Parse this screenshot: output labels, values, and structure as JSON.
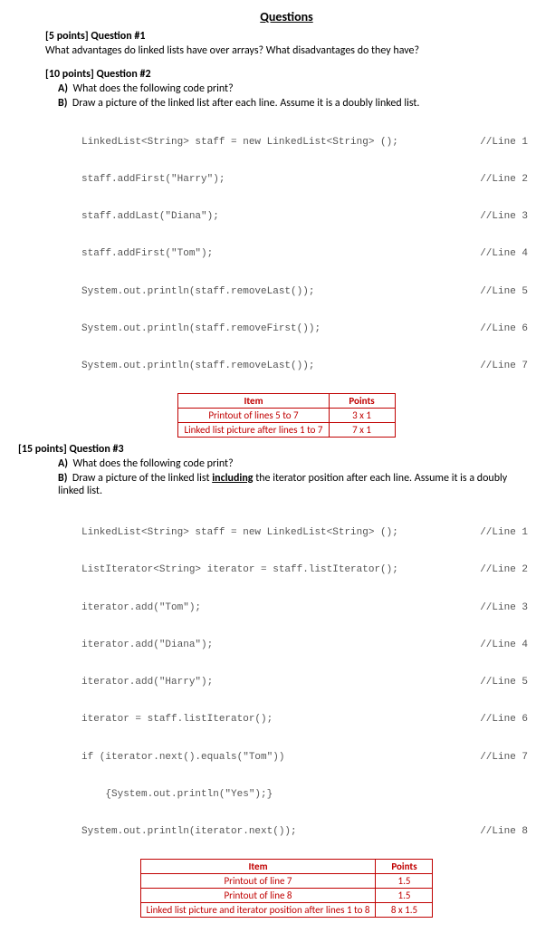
{
  "title": "Questions",
  "q1": {
    "header": "[5 points] Question #1",
    "text": "What advantages do linked lists have over arrays? What disadvantages do they have?"
  },
  "q2": {
    "header": "[10 points] Question #2",
    "partA": "What does the following code print?",
    "partB": "Draw a picture of the linked list after each line. Assume it is a doubly linked list.",
    "code": [
      {
        "l": "LinkedList<String> staff = new LinkedList<String> ();",
        "r": "//Line 1"
      },
      {
        "l": "staff.addFirst(\"Harry\");",
        "r": "//Line 2"
      },
      {
        "l": "staff.addLast(\"Diana\");",
        "r": "//Line 3"
      },
      {
        "l": "staff.addFirst(\"Tom\");",
        "r": "//Line 4"
      },
      {
        "l": "System.out.println(staff.removeLast());",
        "r": "//Line 5"
      },
      {
        "l": "System.out.println(staff.removeFirst());",
        "r": "//Line 6"
      },
      {
        "l": "System.out.println(staff.removeLast());",
        "r": "//Line 7"
      }
    ],
    "rubric": {
      "h1": "Item",
      "h2": "Points",
      "rows": [
        {
          "item": "Printout of lines 5 to 7",
          "pts": "3 x 1"
        },
        {
          "item": "Linked list picture after lines 1 to 7",
          "pts": "7 x 1"
        }
      ]
    }
  },
  "q3": {
    "header": "[15 points] Question #3",
    "partA": "What does the following code print?",
    "partB_pre": "Draw a picture of the linked list ",
    "partB_u": "including",
    "partB_post": " the iterator position after each line. Assume it is a doubly linked list.",
    "code": [
      {
        "l": "LinkedList<String> staff = new LinkedList<String> ();",
        "r": "//Line 1"
      },
      {
        "l": "ListIterator<String> iterator = staff.listIterator();",
        "r": "//Line 2"
      },
      {
        "l": "iterator.add(\"Tom\");",
        "r": "//Line 3"
      },
      {
        "l": "iterator.add(\"Diana\");",
        "r": "//Line 4"
      },
      {
        "l": "iterator.add(\"Harry\");",
        "r": "//Line 5"
      },
      {
        "l": "iterator = staff.listIterator();",
        "r": "//Line 6"
      },
      {
        "l": "if (iterator.next().equals(\"Tom\"))",
        "r": "//Line 7"
      },
      {
        "l": "    {System.out.println(\"Yes\");}",
        "r": ""
      },
      {
        "l": "System.out.println(iterator.next());",
        "r": "//Line 8"
      }
    ],
    "rubric": {
      "h1": "Item",
      "h2": "Points",
      "rows": [
        {
          "item": "Printout of line 7",
          "pts": "1.5"
        },
        {
          "item": "Printout of line 8",
          "pts": "1.5"
        },
        {
          "item": "Linked list picture and iterator position after lines 1 to 8",
          "pts": "8 x 1.5"
        }
      ]
    }
  }
}
